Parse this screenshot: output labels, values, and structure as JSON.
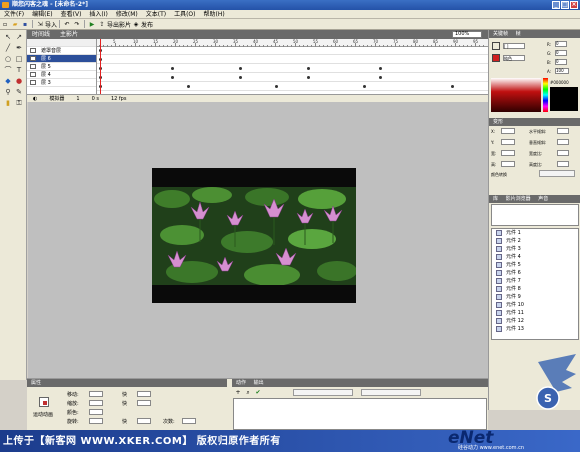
{
  "window": {
    "title": "顺您闪客之魂 - [未命名-2*]",
    "minimize": "_",
    "maximize": "□",
    "close": "×"
  },
  "menu": [
    "文件(F)",
    "编辑(E)",
    "查看(V)",
    "插入(I)",
    "修改(M)",
    "文本(T)",
    "工具(O)",
    "帮助(H)"
  ],
  "toolbar": {
    "import": "导入",
    "export_movie": "导出影片",
    "publish": "发布"
  },
  "timeline": {
    "tab": "时间线",
    "scene": "主影片",
    "zoom": "100%",
    "layers": [
      {
        "name": "遮罩音层"
      },
      {
        "name": "层 6"
      },
      {
        "name": "层 5"
      },
      {
        "name": "层 4"
      },
      {
        "name": "层 3"
      }
    ],
    "ruler": [
      "5",
      "10",
      "15",
      "20",
      "25",
      "30",
      "35",
      "40",
      "45",
      "50",
      "55",
      "60",
      "65",
      "70",
      "75",
      "80",
      "85",
      "90",
      "95"
    ],
    "status": {
      "frame": "1",
      "time": "0 s",
      "fps": "12 fps",
      "mode": "模拟器"
    }
  },
  "right": {
    "tabs": [
      "关键帧",
      "帧",
      "帧信息"
    ],
    "stroke": "[ ]",
    "fill_label": "纯色",
    "hex": "#000000",
    "r": "R:",
    "g": "G:",
    "b": "B:",
    "a": "A:",
    "r_val": "0",
    "g_val": "0",
    "b_val": "0",
    "a_val": "100",
    "xform_tab": "变形",
    "x": "X:",
    "y": "Y:",
    "w": "宽:",
    "h": "高:",
    "hskew": "水平倾斜:",
    "vskew": "垂直倾斜:",
    "wscale": "宽度比:",
    "hscale": "高度比:",
    "color_xf": "颜色转换",
    "library_tabs": [
      "库",
      "影片浏览器",
      "声音"
    ],
    "library": [
      "元件 1",
      "元件 2",
      "元件 3",
      "元件 4",
      "元件 5",
      "元件 6",
      "元件 7",
      "元件 8",
      "元件 9",
      "元件 10",
      "元件 11",
      "元件 12",
      "元件 13"
    ]
  },
  "props": {
    "tab": "属性",
    "motion": "运动动画",
    "move": "移动:",
    "scale": "缩放:",
    "color": "颜色:",
    "rotate": "旋转:",
    "fast": "快",
    "times": "次数:",
    "actions_tab": "动作",
    "output_tab": "输出"
  },
  "footer": {
    "watermark": "上传于【新客网 WWW.XKER.COM】 版权归原作者所有",
    "logo": "eNet",
    "logo_sub": "硅谷动力 www.enet.com.cn",
    "sticker": "S"
  }
}
